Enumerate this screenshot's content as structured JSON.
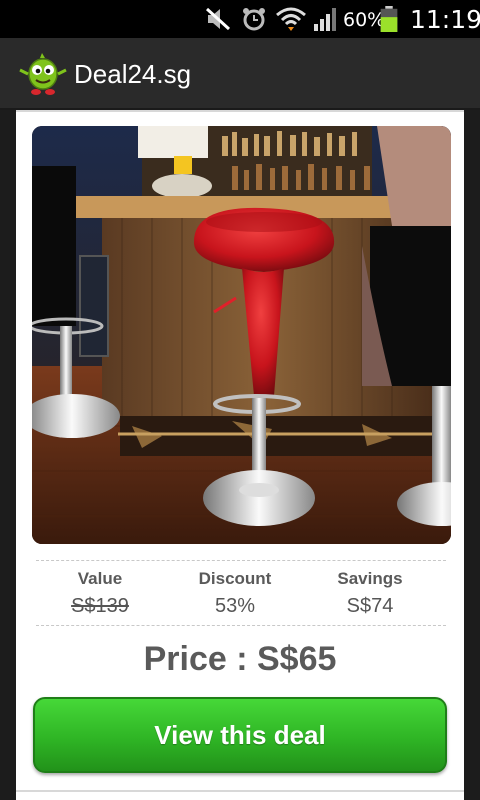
{
  "status_bar": {
    "battery_percent": "60%",
    "time": "11:19",
    "icons": [
      "mute-icon",
      "alarm-icon",
      "wifi-icon",
      "signal-icon",
      "battery-icon"
    ]
  },
  "action_bar": {
    "app_title": "Deal24.sg",
    "logo_icon": "mascot-logo-icon"
  },
  "deal": {
    "image_alt": "red-bar-stool-photo",
    "stats": [
      {
        "label": "Value",
        "value": "S$139"
      },
      {
        "label": "Discount",
        "value": "53%"
      },
      {
        "label": "Savings",
        "value": "S$74"
      }
    ],
    "price": "Price : S$65",
    "cta_label": "View this deal"
  },
  "colors": {
    "cta_green": "#2fb525",
    "action_bar": "#2a2a2a",
    "status_bar": "#000000"
  }
}
